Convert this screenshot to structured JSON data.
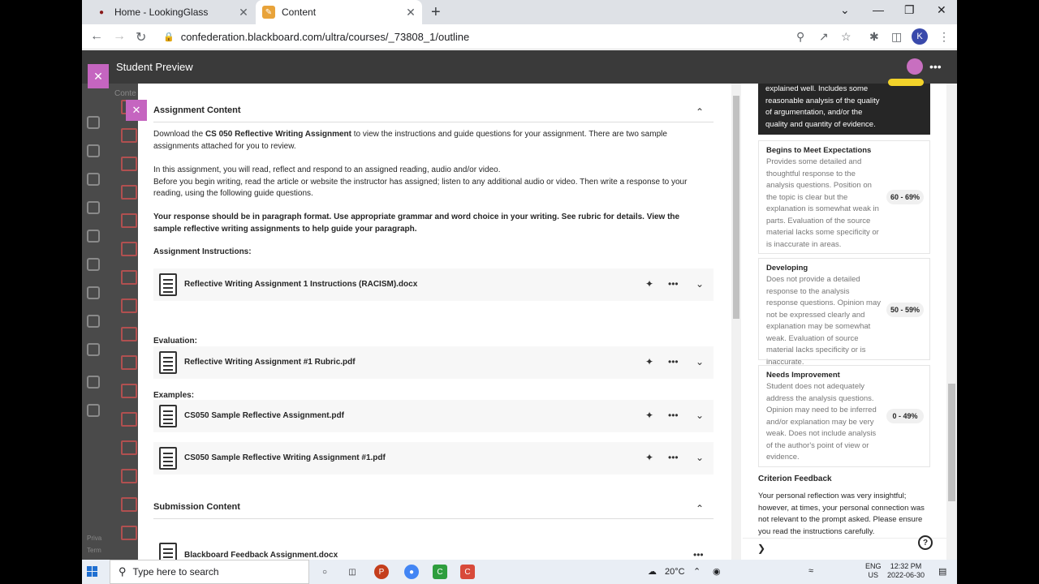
{
  "browser": {
    "tabs": [
      {
        "title": "Home - LookingGlass",
        "active": false
      },
      {
        "title": "Content",
        "active": true
      }
    ],
    "url": "confederation.blackboard.com/ultra/courses/_73808_1/outline",
    "profile_initial": "K"
  },
  "header": {
    "title": "Student Preview"
  },
  "panel": {
    "assignment_content_title": "Assignment Content",
    "download_prefix": "Download the ",
    "download_bold": "CS 050 Reflective Writing Assignment",
    "download_suffix": " to view the instructions and guide questions for your assignment. There are two sample assignments attached for you to review.",
    "para2_line1": "In this assignment, you will read, reflect and respond to an assigned reading, audio and/or video.",
    "para2_line2": "Before you begin writing, read the article or website the instructor has assigned; listen to any additional audio or video. Then write a response to your reading, using the following guide questions.",
    "para3": "Your response should be in paragraph format. Use appropriate grammar and word choice in your writing. See rubric for details. View the sample reflective writing assignments to help guide your paragraph.",
    "instructions_label": "Assignment Instructions:",
    "file_instructions": "Reflective Writing Assignment 1 Instructions (RACISM).docx",
    "evaluation_label": "Evaluation:",
    "file_rubric": "Reflective Writing Assignment #1 Rubric.pdf",
    "examples_label": "Examples:",
    "file_example1": "CS050 Sample Reflective Assignment.pdf",
    "file_example2": "CS050 Sample Reflective Writing Assignment #1.pdf",
    "submission_content_title": "Submission Content",
    "file_submission": "Blackboard Feedback Assignment.docx",
    "side_tab_fragment": "Conte"
  },
  "rubric": {
    "selected_text": "explained well. Includes some reasonable analysis of the quality of argumentation, and/or the quality and quantity of evidence.",
    "criteria": [
      {
        "title": "Begins to Meet Expectations",
        "desc": "Provides some detailed and thoughtful response to the analysis questions. Position on the topic is clear but the explanation is somewhat weak in parts. Evaluation of the source material lacks some specificity or is inaccurate in areas.",
        "points": "60 - 69%"
      },
      {
        "title": "Developing",
        "desc": "Does not provide a detailed response to the analysis response questions. Opinion may not be expressed clearly and explanation may be somewhat weak. Evaluation of source material lacks specificity or is inaccurate.",
        "points": "50 - 59%"
      },
      {
        "title": "Needs Improvement",
        "desc": "Student does not adequately address the analysis questions. Opinion may need to be inferred and/or explanation may be very weak. Does not include analysis of the author's point of view or evidence.",
        "points": "0 - 49%"
      }
    ],
    "feedback_title": "Criterion Feedback",
    "feedback_text": "Your personal reflection was very insightful; however, at times, your personal connection was not relevant to the prompt asked. Please ensure you read the instructions carefully."
  },
  "taskbar": {
    "search_placeholder": "Type here to search",
    "weather": "20°C",
    "lang1": "ENG",
    "lang2": "US",
    "time": "12:32 PM",
    "date": "2022-06-30"
  },
  "sidebar_footer": [
    "Priva",
    "Term"
  ]
}
